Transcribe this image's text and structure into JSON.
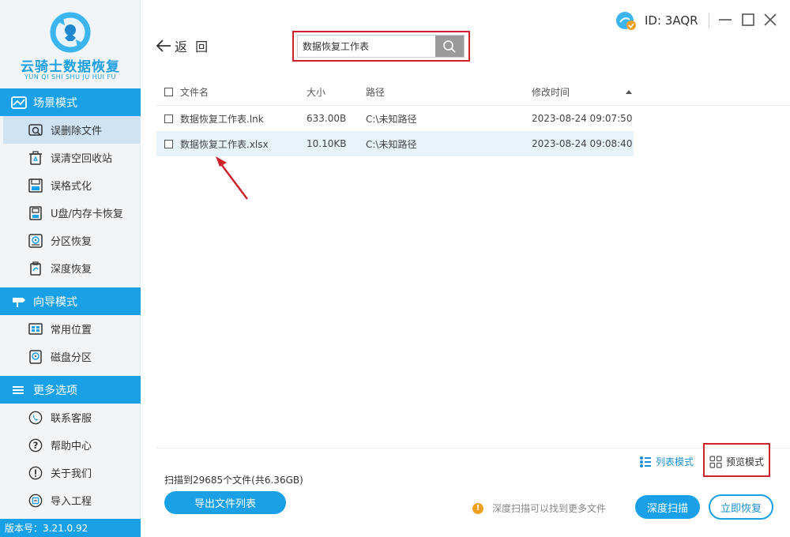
{
  "app": {
    "logo_title": "云骑士数据恢复",
    "logo_subtitle": "YUN QI SHI SHU JU HUI FU",
    "version": "版本号：3.21.0.92"
  },
  "sidebar": {
    "sections": [
      {
        "title": "场景模式",
        "icon": "scene-icon",
        "items": [
          {
            "label": "误删除文件",
            "icon": "deleted-file-icon",
            "active": true
          },
          {
            "label": "误清空回收站",
            "icon": "recycle-bin-icon"
          },
          {
            "label": "误格式化",
            "icon": "format-icon"
          },
          {
            "label": "U盘/内存卡恢复",
            "icon": "usb-card-icon"
          },
          {
            "label": "分区恢复",
            "icon": "partition-icon"
          },
          {
            "label": "深度恢复",
            "icon": "deep-recover-icon"
          }
        ]
      },
      {
        "title": "向导模式",
        "icon": "signpost-icon",
        "items": [
          {
            "label": "常用位置",
            "icon": "windows-icon"
          },
          {
            "label": "磁盘分区",
            "icon": "disk-icon"
          }
        ]
      },
      {
        "title": "更多选项",
        "icon": "menu-icon",
        "items": [
          {
            "label": "联系客服",
            "icon": "phone-icon"
          },
          {
            "label": "帮助中心",
            "icon": "question-icon"
          },
          {
            "label": "关于我们",
            "icon": "exclamation-icon"
          },
          {
            "label": "导入工程",
            "icon": "import-icon"
          }
        ]
      }
    ]
  },
  "topbar": {
    "account_id": "ID: 3AQR",
    "back_label": "返  回",
    "minimize": "—",
    "maximize": "☐",
    "close": "✕"
  },
  "search": {
    "value": "数据恢复工作表",
    "placeholder": ""
  },
  "table": {
    "columns": {
      "name": "文件名",
      "size": "大小",
      "path": "路径",
      "time": "修改时间"
    },
    "rows": [
      {
        "name": "数据恢复工作表.lnk",
        "size": "633.00B",
        "path": "C:\\未知路径",
        "time": "2023-08-24 09:07:50",
        "selected": false
      },
      {
        "name": "数据恢复工作表.xlsx",
        "size": "10.10KB",
        "path": "C:\\未知路径",
        "time": "2023-08-24 09:08:40",
        "selected": true
      }
    ]
  },
  "view_modes": {
    "list": "列表模式",
    "preview": "预览模式"
  },
  "footer": {
    "scan_info": "扫描到29685个文件(共6.36GB)",
    "export_label": "导出文件列表",
    "tip": "深度扫描可以找到更多文件",
    "deep_scan_label": "深度扫描",
    "recover_label": "立即恢复"
  },
  "colors": {
    "accent": "#1aa0e6",
    "highlight_box": "#d0222a",
    "tip_icon": "#f0a020"
  }
}
